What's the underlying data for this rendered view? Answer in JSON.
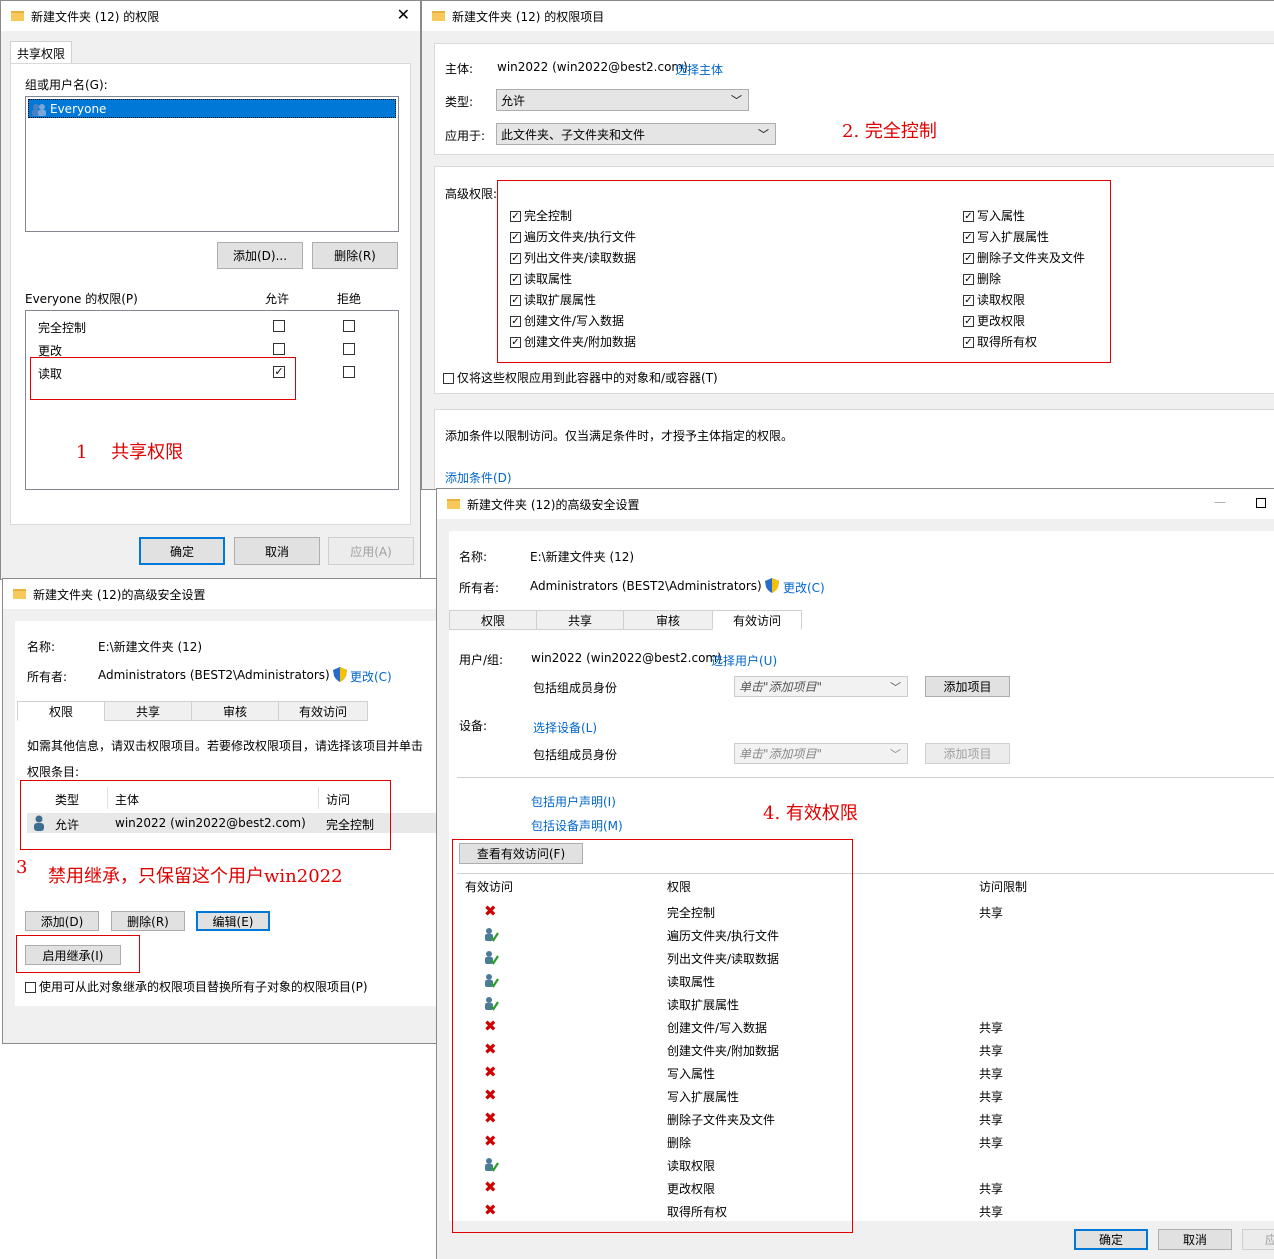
{
  "share_win": {
    "title": "新建文件夹 (12) 的权限",
    "tab": "共享权限",
    "group_label": "组或用户名(G):",
    "user": "Everyone",
    "add_btn": "添加(D)...",
    "remove_btn": "删除(R)",
    "perm_label": "Everyone 的权限(P)",
    "allow_col": "允许",
    "deny_col": "拒绝",
    "perms": [
      {
        "name": "完全控制",
        "allow": false,
        "deny": false
      },
      {
        "name": "更改",
        "allow": false,
        "deny": false
      },
      {
        "name": "读取",
        "allow": true,
        "deny": false
      }
    ],
    "ok": "确定",
    "cancel": "取消",
    "apply": "应用(A)",
    "annotation": "1　 共享权限"
  },
  "entry_win": {
    "title": "新建文件夹 (12) 的权限项目",
    "principal_label": "主体:",
    "principal": "win2022 (win2022@best2.com)",
    "select_principal": "选择主体",
    "type_label": "类型:",
    "type_value": "允许",
    "applies_label": "应用于:",
    "applies_value": "此文件夹、子文件夹和文件",
    "annotation": "2. 完全控制",
    "adv_label": "高级权限:",
    "left_perms": [
      "完全控制",
      "遍历文件夹/执行文件",
      "列出文件夹/读取数据",
      "读取属性",
      "读取扩展属性",
      "创建文件/写入数据",
      "创建文件夹/附加数据"
    ],
    "right_perms": [
      "写入属性",
      "写入扩展属性",
      "删除子文件夹及文件",
      "删除",
      "读取权限",
      "更改权限",
      "取得所有权"
    ],
    "apply_only": "仅将这些权限应用到此容器中的对象和/或容器(T)",
    "cond_text": "添加条件以限制访问。仅当满足条件时，才授予主体指定的权限。",
    "add_cond": "添加条件(D)"
  },
  "adv_win1": {
    "title": "新建文件夹 (12)的高级安全设置",
    "name_label": "名称:",
    "name_value": "E:\\新建文件夹 (12)",
    "owner_label": "所有者:",
    "owner_value": "Administrators (BEST2\\Administrators)",
    "change": "更改(C)",
    "tabs": [
      "权限",
      "共享",
      "审核",
      "有效访问"
    ],
    "info": "如需其他信息，请双击权限项目。若要修改权限项目，请选择该项目并单击",
    "entries_label": "权限条目:",
    "col_type": "类型",
    "col_principal": "主体",
    "col_access": "访问",
    "row_type": "允许",
    "row_principal": "win2022 (win2022@best2.com)",
    "row_access": "完全控制",
    "annotation_num": "3",
    "annotation": "禁用继承，只保留这个用户win2022",
    "add": "添加(D)",
    "remove": "删除(R)",
    "edit": "编辑(E)",
    "enable_inherit": "启用继承(I)",
    "replace": "使用可从此对象继承的权限项目替换所有子对象的权限项目(P)"
  },
  "adv_win2": {
    "title": "新建文件夹 (12)的高级安全设置",
    "name_label": "名称:",
    "name_value": "E:\\新建文件夹 (12)",
    "owner_label": "所有者:",
    "owner_value": "Administrators (BEST2\\Administrators)",
    "change": "更改(C)",
    "tabs": [
      "权限",
      "共享",
      "审核",
      "有效访问"
    ],
    "user_label": "用户/组:",
    "user_value": "win2022 (win2022@best2.com)",
    "select_user": "选择用户(U)",
    "include_group": "包括组成员身份",
    "click_add": "单击\"添加项目\"",
    "add_item": "添加项目",
    "device_label": "设备:",
    "select_device": "选择设备(L)",
    "include_user_claims": "包括用户声明(I)",
    "include_device_claims": "包括设备声明(M)",
    "annotation": "4. 有效权限",
    "view_btn": "查看有效访问(F)",
    "col_effective": "有效访问",
    "col_perm": "权限",
    "col_limit": "访问限制",
    "rows": [
      {
        "ok": false,
        "perm": "完全控制",
        "limit": "共享"
      },
      {
        "ok": true,
        "perm": "遍历文件夹/执行文件",
        "limit": ""
      },
      {
        "ok": true,
        "perm": "列出文件夹/读取数据",
        "limit": ""
      },
      {
        "ok": true,
        "perm": "读取属性",
        "limit": ""
      },
      {
        "ok": true,
        "perm": "读取扩展属性",
        "limit": ""
      },
      {
        "ok": false,
        "perm": "创建文件/写入数据",
        "limit": "共享"
      },
      {
        "ok": false,
        "perm": "创建文件夹/附加数据",
        "limit": "共享"
      },
      {
        "ok": false,
        "perm": "写入属性",
        "limit": "共享"
      },
      {
        "ok": false,
        "perm": "写入扩展属性",
        "limit": "共享"
      },
      {
        "ok": false,
        "perm": "删除子文件夹及文件",
        "limit": "共享"
      },
      {
        "ok": false,
        "perm": "删除",
        "limit": "共享"
      },
      {
        "ok": true,
        "perm": "读取权限",
        "limit": ""
      },
      {
        "ok": false,
        "perm": "更改权限",
        "limit": "共享"
      },
      {
        "ok": false,
        "perm": "取得所有权",
        "limit": "共享"
      }
    ],
    "ok": "确定",
    "cancel": "取消",
    "apply": "应"
  }
}
